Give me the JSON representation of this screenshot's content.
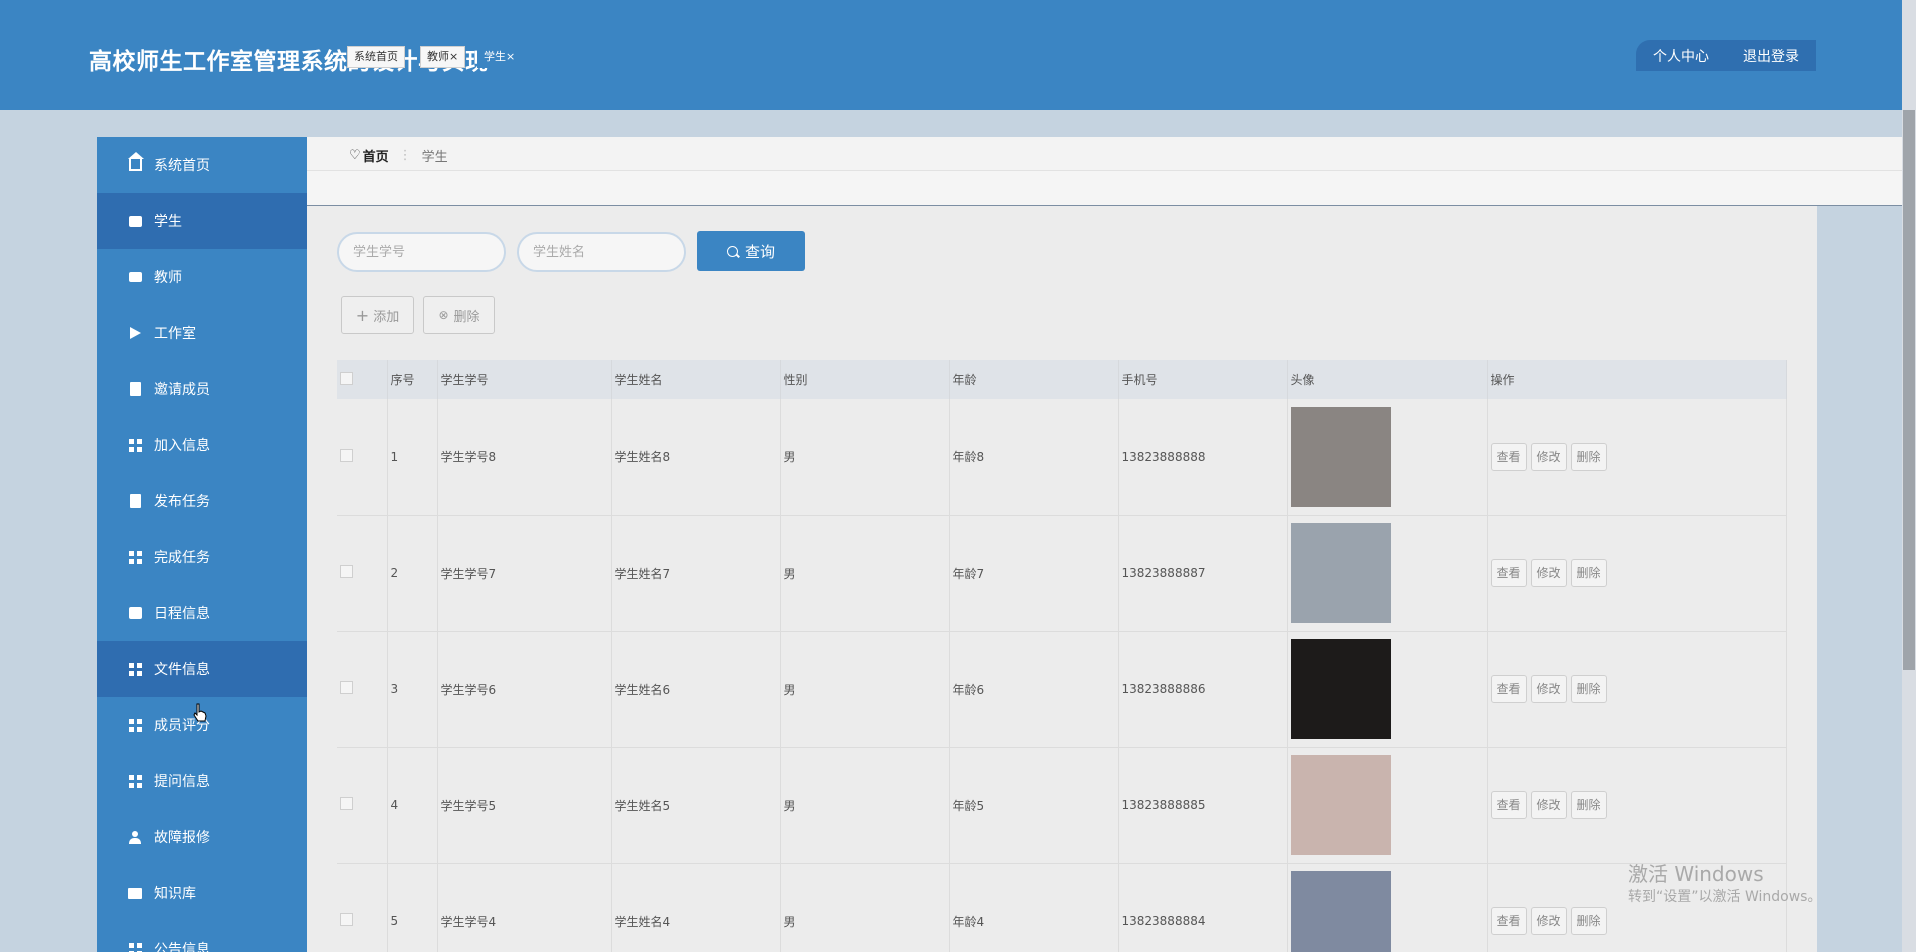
{
  "header": {
    "title": "高校师生工作室管理系统的设计与实现",
    "personal_center": "个人中心",
    "logout": "退出登录"
  },
  "sidebar": {
    "items": [
      {
        "label": "系统首页",
        "icon": "home-icon",
        "active": false
      },
      {
        "label": "学生",
        "icon": "briefcase-icon",
        "active": true
      },
      {
        "label": "教师",
        "icon": "chart-icon",
        "active": false
      },
      {
        "label": "工作室",
        "icon": "flag-icon",
        "active": false
      },
      {
        "label": "邀请成员",
        "icon": "clipboard-icon",
        "active": false
      },
      {
        "label": "加入信息",
        "icon": "grid-icon",
        "active": false
      },
      {
        "label": "发布任务",
        "icon": "clipboard-icon",
        "active": false
      },
      {
        "label": "完成任务",
        "icon": "grid-icon",
        "active": false
      },
      {
        "label": "日程信息",
        "icon": "box-icon",
        "active": false
      },
      {
        "label": "文件信息",
        "icon": "grid-icon",
        "active": true
      },
      {
        "label": "成员评分",
        "icon": "grid-icon",
        "active": false
      },
      {
        "label": "提问信息",
        "icon": "grid-icon",
        "active": false
      },
      {
        "label": "故障报修",
        "icon": "user-icon",
        "active": false
      },
      {
        "label": "知识库",
        "icon": "monitor-icon",
        "active": false
      },
      {
        "label": "公告信息",
        "icon": "grid-icon",
        "active": false
      }
    ]
  },
  "breadcrumb": {
    "home": "首页",
    "separator": "⋮",
    "current": "学生"
  },
  "tabs": [
    {
      "label": "系统首页"
    },
    {
      "label": "教师×"
    },
    {
      "label": "学生×"
    }
  ],
  "search": {
    "student_id_placeholder": "学生学号",
    "student_name_placeholder": "学生姓名",
    "query_label": "查询"
  },
  "actions": {
    "add_label": "添加",
    "delete_label": "删除"
  },
  "table": {
    "columns": [
      "序号",
      "学生学号",
      "学生姓名",
      "性别",
      "年龄",
      "手机号",
      "头像",
      "操作"
    ],
    "rows": [
      {
        "index": "1",
        "student_id": "学生学号8",
        "name": "学生姓名8",
        "gender": "男",
        "age": "年龄8",
        "phone": "13823888888",
        "avatar_color": "#8a8582"
      },
      {
        "index": "2",
        "student_id": "学生学号7",
        "name": "学生姓名7",
        "gender": "男",
        "age": "年龄7",
        "phone": "13823888887",
        "avatar_color": "#9aa3ad"
      },
      {
        "index": "3",
        "student_id": "学生学号6",
        "name": "学生姓名6",
        "gender": "男",
        "age": "年龄6",
        "phone": "13823888886",
        "avatar_color": "#1d1b1a"
      },
      {
        "index": "4",
        "student_id": "学生学号5",
        "name": "学生姓名5",
        "gender": "男",
        "age": "年龄5",
        "phone": "13823888885",
        "avatar_color": "#c9b4ae"
      },
      {
        "index": "5",
        "student_id": "学生学号4",
        "name": "学生姓名4",
        "gender": "男",
        "age": "年龄4",
        "phone": "13823888884",
        "avatar_color": "#7f8aa0"
      }
    ],
    "row_actions": {
      "view": "查看",
      "edit": "修改",
      "delete": "删除"
    }
  },
  "watermark": {
    "line1": "激活 Windows",
    "line2": "转到“设置”以激活 Windows。"
  },
  "colors": {
    "primary": "#3b85c3",
    "primary_dark": "#2f6db0",
    "background": "#c5d3e0"
  }
}
